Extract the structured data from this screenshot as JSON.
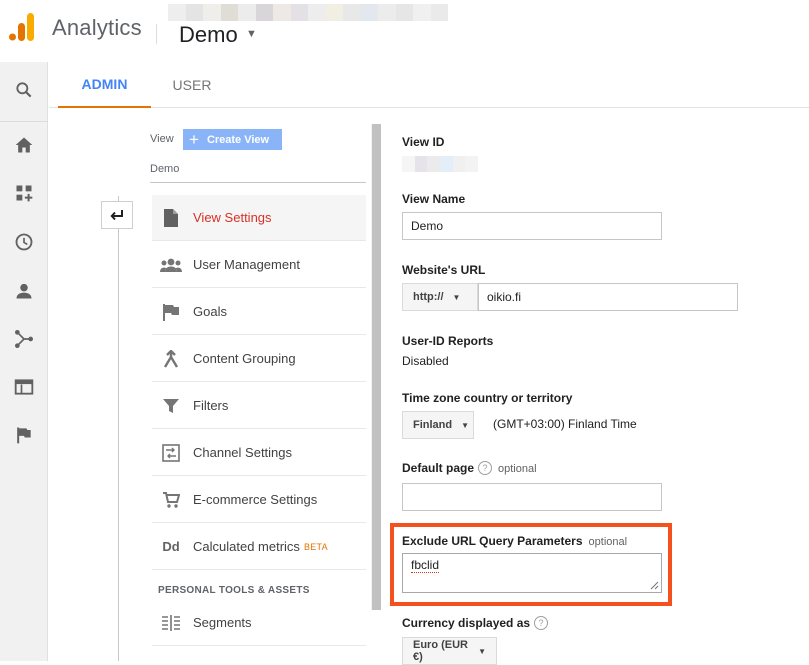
{
  "header": {
    "product_name": "Analytics",
    "account_name": "Demo",
    "logo_colors": [
      "#f9ab00",
      "#e37400"
    ]
  },
  "rail": {
    "icons": [
      "search-icon",
      "home-icon",
      "customization-icon",
      "clock-icon",
      "person-icon",
      "acquisition-icon",
      "behavior-icon",
      "flag-icon"
    ]
  },
  "tabs": [
    {
      "label": "ADMIN",
      "active": true
    },
    {
      "label": "USER",
      "active": false
    }
  ],
  "view_panel": {
    "view_label": "View",
    "create_view_label": "Create View",
    "selected_view": "Demo",
    "back_icon": "back-arrow-icon",
    "menu": [
      {
        "label": "View Settings",
        "icon": "document-icon",
        "active": true
      },
      {
        "label": "User Management",
        "icon": "people-icon",
        "active": false
      },
      {
        "label": "Goals",
        "icon": "flag-icon",
        "active": false
      },
      {
        "label": "Content Grouping",
        "icon": "grouping-icon",
        "active": false
      },
      {
        "label": "Filters",
        "icon": "filter-icon",
        "active": false
      },
      {
        "label": "Channel Settings",
        "icon": "channel-icon",
        "active": false
      },
      {
        "label": "E-commerce Settings",
        "icon": "cart-icon",
        "active": false
      },
      {
        "label": "Calculated metrics",
        "icon": "dd-icon",
        "icon_text": "Dd",
        "badge": "BETA",
        "active": false
      }
    ],
    "tools_heading": "PERSONAL TOOLS & ASSETS",
    "tools_menu": [
      {
        "label": "Segments",
        "icon": "segments-icon"
      }
    ]
  },
  "settings": {
    "view_id_label": "View ID",
    "view_name_label": "View Name",
    "view_name_value": "Demo",
    "website_url_label": "Website's URL",
    "protocol_value": "http://",
    "website_url_value": "oikio.fi",
    "user_id_label": "User-ID Reports",
    "user_id_value": "Disabled",
    "timezone_label": "Time zone country or territory",
    "timezone_country": "Finland",
    "timezone_value": "(GMT+03:00) Finland Time",
    "default_page_label": "Default page",
    "default_page_help": "?",
    "default_page_optional": "optional",
    "default_page_value": "",
    "exclude_label": "Exclude URL Query Parameters",
    "exclude_optional": "optional",
    "exclude_value": "fbclid",
    "currency_label": "Currency displayed as",
    "currency_help": "?",
    "currency_value": "Euro (EUR €)"
  },
  "colors": {
    "accent_blue": "#4285f4",
    "active_red": "#d93025",
    "highlight_orange": "#f4511e",
    "tab_underline": "#e37400"
  }
}
